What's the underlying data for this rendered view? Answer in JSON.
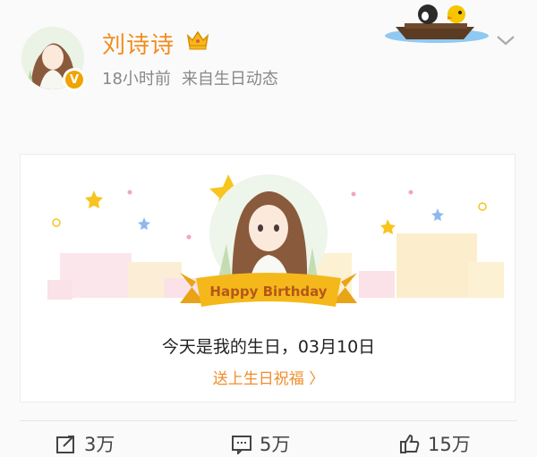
{
  "post": {
    "user_name": "刘诗诗",
    "time": "18小时前",
    "source": "来自生日动态"
  },
  "card": {
    "banner_text": "Happy Birthday",
    "birthday_text": "今天是我的生日，03月10日",
    "wish_link": "送上生日祝福 〉"
  },
  "actions": {
    "repost_count": "3万",
    "comment_count": "5万",
    "like_count": "15万"
  },
  "colors": {
    "name": "#f28c1d",
    "accent": "#f08c2b",
    "badge": "#f0a400",
    "banner": "#f5b81a"
  },
  "icons": [
    "crown-icon",
    "verified-badge-icon",
    "chevron-down-icon",
    "repost-icon",
    "comment-icon",
    "like-icon"
  ]
}
